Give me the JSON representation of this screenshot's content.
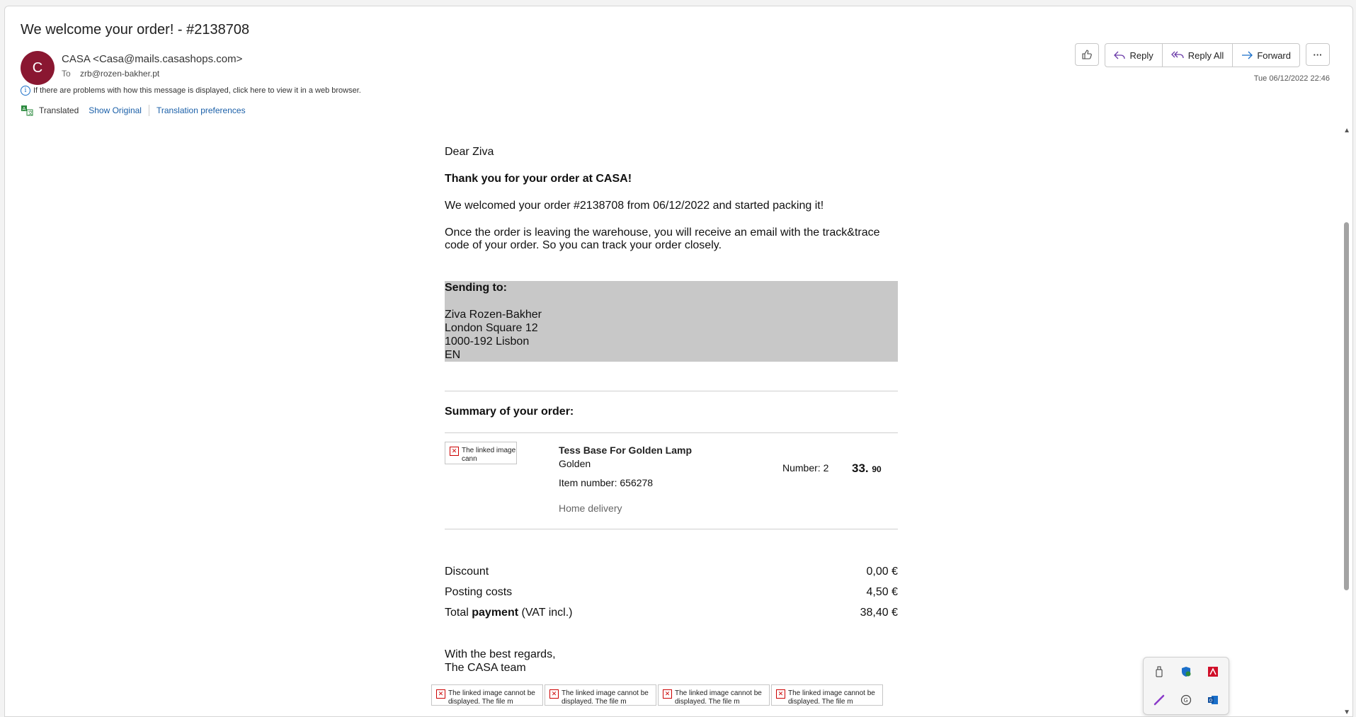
{
  "email": {
    "subject": "We welcome your order! - #2138708",
    "avatar_letter": "C",
    "sender": "CASA <Casa@mails.casashops.com>",
    "to_label": "To",
    "to_address": "zrb@rozen-bakher.pt",
    "info_text": "If there are problems with how this message is displayed, click here to view it in a web browser.",
    "translated_label": "Translated",
    "show_original": "Show Original",
    "translation_prefs": "Translation preferences",
    "date": "Tue 06/12/2022 22:46"
  },
  "toolbar": {
    "reply": "Reply",
    "reply_all": "Reply All",
    "forward": "Forward",
    "more": "···"
  },
  "body": {
    "greeting": "Dear Ziva",
    "thanks": "Thank you for your order at CASA!",
    "welcomed": "We welcomed your order #2138708 from 06/12/2022 and started packing it!",
    "leaving": "Once the order is leaving the warehouse, you will receive an email with the track&trace code of your order. So you can track your order closely.",
    "sending_to": "Sending to:",
    "address": [
      "Ziva Rozen-Bakher",
      "London Square 12",
      "1000-192 Lisbon",
      "EN"
    ],
    "summary_title": "Summary of your order:",
    "product": {
      "image_alt": "The linked image cann",
      "name": "Tess Base For Golden Lamp",
      "color": "Golden",
      "item_number": "Item number: 656278",
      "delivery": "Home delivery",
      "number": "Number: 2",
      "price_main": "33.",
      "price_cents": "90"
    },
    "totals": [
      {
        "label": "Discount",
        "value": "0,00 €"
      },
      {
        "label": "Posting costs",
        "value": "4,50 €"
      }
    ],
    "total_prefix": "Total ",
    "total_bold": "payment",
    "total_suffix": " (VAT incl.)",
    "total_value": "38,40 €",
    "regards_1": "With the best regards,",
    "regards_2": "The CASA team",
    "footer_image_text": "The linked image cannot be displayed. The file m"
  }
}
